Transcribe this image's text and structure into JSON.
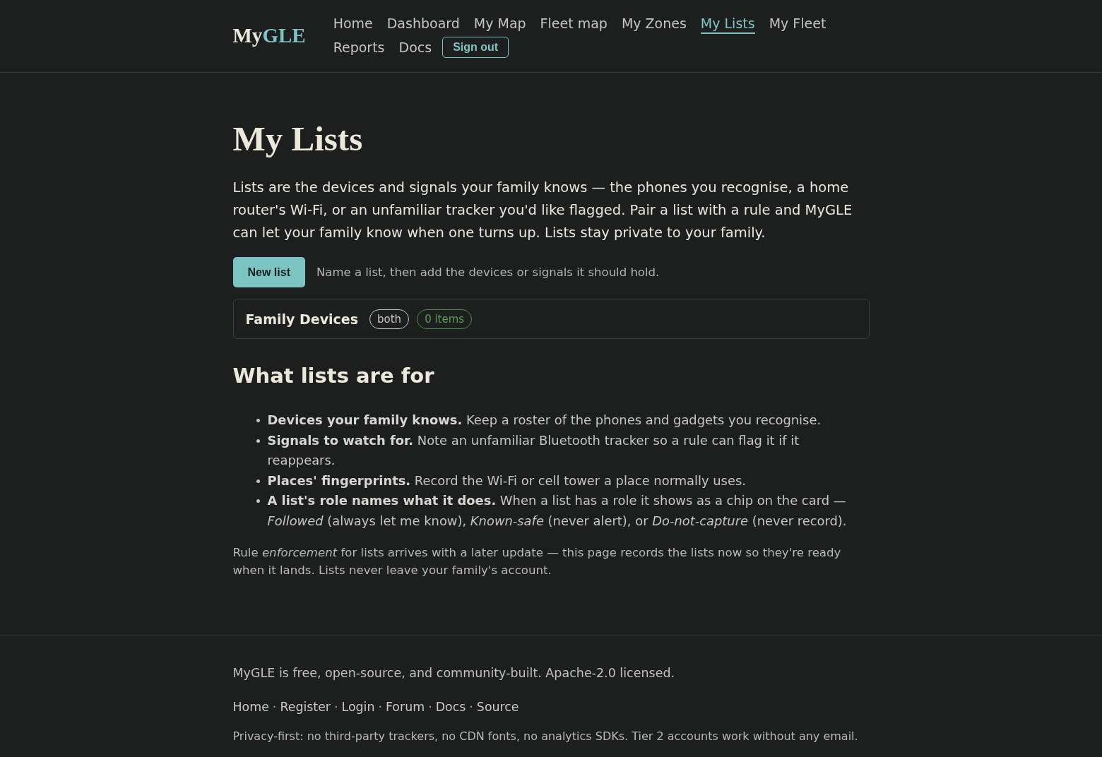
{
  "header": {
    "logo": [
      {
        "text": "My",
        "kind": "plain"
      },
      {
        "text": "GLE",
        "kind": "accent"
      }
    ],
    "nav": {
      "items": [
        {
          "label": "Home",
          "selected": false
        },
        {
          "label": "Dashboard",
          "selected": false
        },
        {
          "label": "My Map",
          "selected": false
        },
        {
          "label": "Fleet map",
          "selected": false
        },
        {
          "label": "My Zones",
          "selected": false
        },
        {
          "label": "My Lists",
          "selected": true
        },
        {
          "label": "My Fleet",
          "selected": false
        },
        {
          "label": "Reports",
          "selected": false
        },
        {
          "label": "Docs",
          "selected": false
        }
      ],
      "button": "Sign out"
    }
  },
  "page_title": "My Lists",
  "intro": "Lists are the devices and signals your family knows — the phones you recognise, a home router's Wi-Fi, or an unfamiliar tracker you'd like flagged. Pair a list with a rule and MyGLE can let your family know when one turns up. Lists stay private to your family.",
  "new_list": {
    "button": "New list",
    "hint": "Name a list, then add the devices or signals it should hold."
  },
  "lists": [
    {
      "name": "Family Devices",
      "chips": [
        {
          "label": "both",
          "kind": "scope"
        },
        {
          "label": "0 items",
          "kind": "count"
        }
      ]
    }
  ],
  "section": {
    "heading": "What lists are for",
    "items": [
      "**Devices your family knows.** Keep a roster of the phones and gadgets you recognise.",
      "**Signals to watch for.** Note an unfamiliar Bluetooth tracker so a rule can flag it if it reappears.",
      "**Places' fingerprints.** Record the Wi-Fi or cell tower a place normally uses.",
      "**A list's role names what it does.** When a list has a role it shows as a chip on the card — *Followed* (always let me know), *Known-safe* (never alert), or *Do-not-capture* (never record)."
    ]
  },
  "note": "Rule *enforcement* for lists arrives with a later update — this page records the lists now so they're ready when it lands. Lists never leave your family's account.",
  "footer": {
    "tagline": "MyGLE is free, open-source, and community-built. Apache-2.0 licensed.",
    "links": [
      "Home",
      "Register",
      "Login",
      "Forum",
      "Docs",
      "Source"
    ],
    "separator": "·",
    "privacy": "Privacy-first: no third-party trackers, no CDN fonts, no analytics SDKs. Tier 2 accounts work without any email."
  }
}
